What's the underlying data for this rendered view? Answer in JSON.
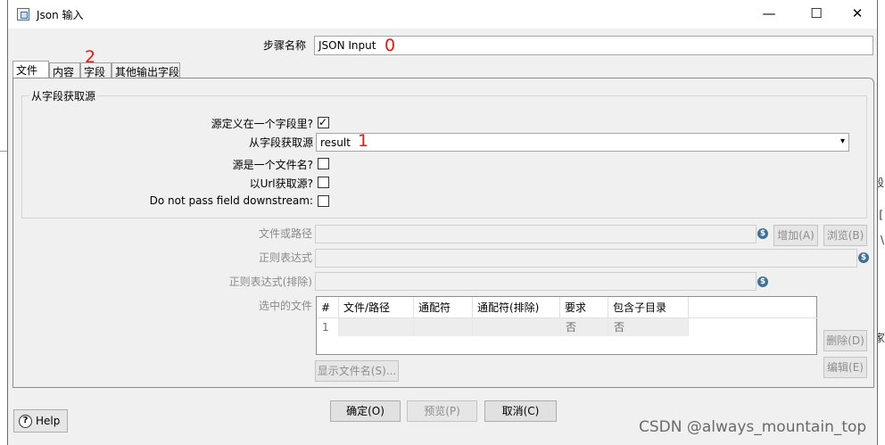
{
  "window": {
    "title": "Json 输入",
    "minimize_glyph": "—",
    "maximize_glyph": "☐",
    "close_glyph": "✕"
  },
  "step_name": {
    "label": "步骤名称",
    "value": "JSON Input"
  },
  "annotations": {
    "mark0": "0",
    "mark1": "1",
    "mark2": "2"
  },
  "tabs": [
    {
      "label": "文件",
      "active": true
    },
    {
      "label": "内容",
      "active": false
    },
    {
      "label": "字段",
      "active": false
    },
    {
      "label": "其他输出字段",
      "active": false
    }
  ],
  "source_group": {
    "title": "从字段获取源",
    "source_in_field": {
      "label": "源定义在一个字段里?",
      "checked": true
    },
    "get_source_from": {
      "label": "从字段获取源",
      "value": "result"
    },
    "source_is_filename": {
      "label": "源是一个文件名?",
      "checked": false
    },
    "read_source_as_url": {
      "label": "以Url获取源?",
      "checked": false
    },
    "do_not_pass_field": {
      "label": "Do not pass field downstream:",
      "checked": false
    }
  },
  "file_section": {
    "file_or_dir_label": "文件或路径",
    "regex_label": "正则表达式",
    "regex_exclude_label": "正则表达式(排除)",
    "selected_files_label": "选中的文件",
    "add_button": "增加(A)",
    "browse_button": "浏览(B)",
    "delete_button": "删除(D)",
    "edit_button": "编辑(E)",
    "show_filenames_button": "显示文件名(S)...",
    "variable_icon": "$"
  },
  "files_table": {
    "columns": [
      "#",
      "文件/路径",
      "通配符",
      "通配符(排除)",
      "要求",
      "包含子目录"
    ],
    "rows": [
      {
        "num": "1",
        "path": "",
        "wildcard": "",
        "exclude": "",
        "required": "否",
        "subdirs": "否"
      }
    ]
  },
  "footer": {
    "ok": "确定(O)",
    "preview": "预览(P)",
    "cancel": "取消(C)",
    "help": "Help",
    "help_icon": "?"
  },
  "watermark": "CSDN @always_mountain_top",
  "background_edge": {
    "t1": "段",
    "t2": "[",
    "t3": "\\",
    "t4": "家"
  }
}
